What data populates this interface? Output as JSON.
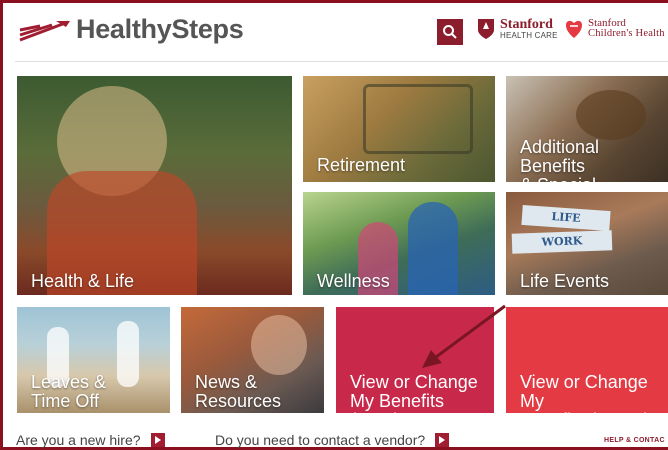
{
  "header": {
    "brand_healthy": "Healthy",
    "brand_steps": "Steps",
    "stanford_hc_line1": "Stanford",
    "stanford_hc_line2": "HEALTH CARE",
    "stanford_ch_line1": "Stanford",
    "stanford_ch_line2": "Children's Health"
  },
  "tiles": {
    "health_life": "Health & Life",
    "retirement": "Retirement",
    "additional_benefits": "Additional Benefits\n& Special Programs",
    "wellness": "Wellness",
    "life_events": "Life Events",
    "leaves": "Leaves &\nTime Off",
    "news": "News &\nResources",
    "view_shc": "View or Change\nMy Benefits (SHC)",
    "view_lpch": "View or Change My\nBenefits (LPCH)"
  },
  "sign": {
    "life": "LIFE",
    "work": "WORK"
  },
  "footer": {
    "new_hire": "Are you a new hire?",
    "contact_vendor": "Do you need to contact a vendor?",
    "help_contact": "HELP & CONTAC"
  },
  "colors": {
    "brand_red": "#8c1d2c",
    "tile_shc": "#c8294a",
    "tile_lpch": "#e33a44"
  }
}
